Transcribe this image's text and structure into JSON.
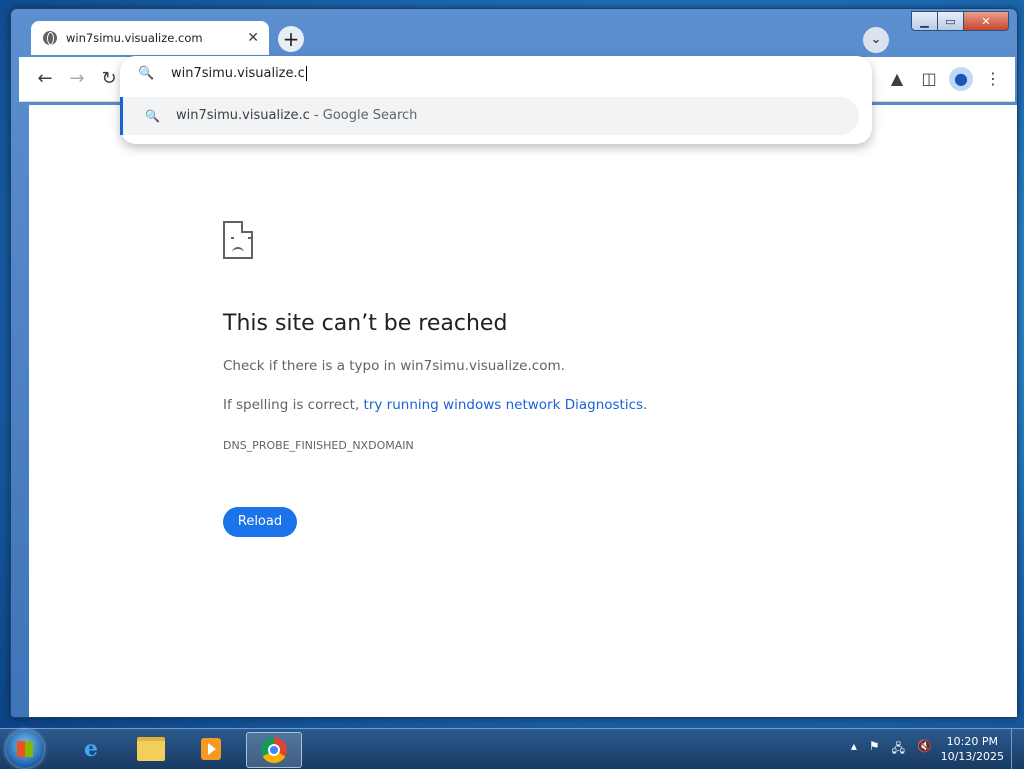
{
  "window": {
    "controls": {
      "minimize": "▁",
      "maximize": "▭",
      "close": "✕"
    }
  },
  "tab": {
    "title": "win7simu.visualize.com",
    "close": "✕",
    "favicon": "globe-icon"
  },
  "newtab_label": "+",
  "tab_menu_label": "⌄",
  "toolbar": {
    "back": "←",
    "forward": "→",
    "reload": "↻",
    "extensions": "▲",
    "sidepanel": "◫",
    "profile": "●",
    "menu": "⋮"
  },
  "omnibox": {
    "query": "win7simu.visualize.c",
    "search_icon": "🔍",
    "suggestion": {
      "text": "win7simu.visualize.c",
      "separator": " - ",
      "source": "Google Search"
    }
  },
  "page": {
    "title": "This site can’t be reached",
    "line1": "Check if there is a typo in win7simu.visualize.com.",
    "line2_prefix": "If spelling is correct, ",
    "line2_link": "try running windows network Diagnostics",
    "line2_suffix": ".",
    "error_code": "DNS_PROBE_FINISHED_NXDOMAIN",
    "reload_label": "Reload"
  },
  "taskbar": {
    "apps": [
      "internet-explorer",
      "file-explorer",
      "media-player",
      "chrome"
    ],
    "tray": {
      "show_hidden": "▴",
      "flag": "⚑",
      "network": "🖧",
      "volume": "🔇"
    },
    "time": "10:20 PM",
    "date": "10/13/2025"
  },
  "colors": {
    "accent": "#1a73e8",
    "link": "#1a62d6",
    "taskbar": "#183a63"
  }
}
